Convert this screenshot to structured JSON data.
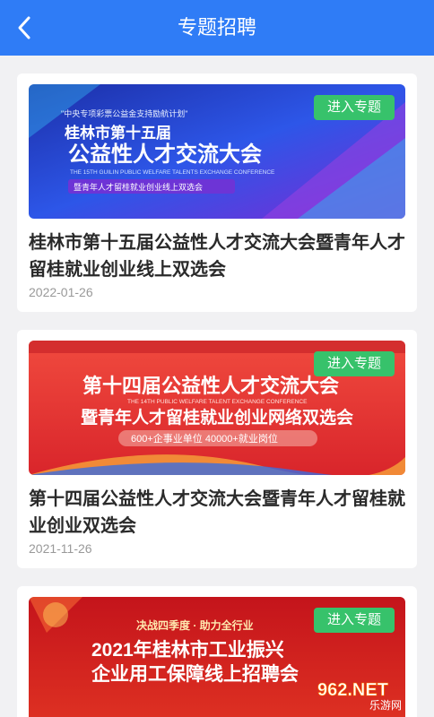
{
  "header": {
    "title": "专题招聘",
    "back_icon": "chevron-left-icon"
  },
  "enter_label": "进入专题",
  "cards": [
    {
      "title": "桂林市第十五届公益性人才交流大会暨青年人才留桂就业创业线上双选会",
      "date": "2022-01-26",
      "banner": {
        "top": "\"中央专项彩票公益金支持励航计划\"",
        "line1": "桂林市第十五届",
        "line2": "公益性人才交流大会",
        "english": "THE 15TH GUILIN PUBLIC WELFARE TALENTS EXCHANGE CONFERENCE",
        "sub": "暨青年人才留桂就业创业线上双选会"
      }
    },
    {
      "title": "第十四届公益性人才交流大会暨青年人才留桂就业创业双选会",
      "date": "2021-11-26",
      "banner": {
        "line1": "第十四届公益性人才交流大会",
        "english": "THE 14TH PUBLIC WELFARE TALENT EXCHANGE CONFERENCE",
        "line2": "暨青年人才留桂就业创业网络双选会",
        "stats": "600+企事业单位  40000+就业岗位"
      }
    },
    {
      "banner": {
        "slogan": "决战四季度 · 助力全行业",
        "line1": "2021年桂林市工业振兴",
        "line2": "企业用工保障线上招聘会"
      }
    }
  ],
  "watermark": {
    "brand": "962.NET",
    "sub": "乐游网"
  }
}
